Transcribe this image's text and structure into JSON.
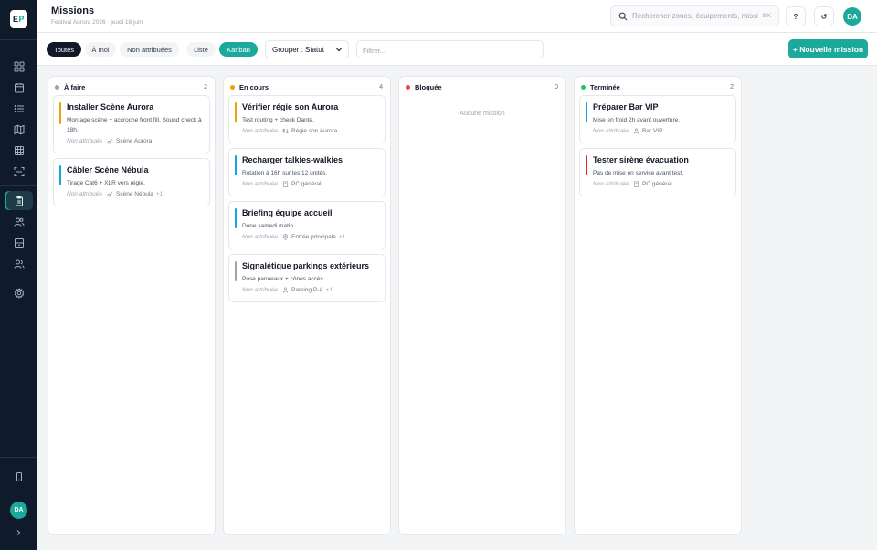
{
  "app": {
    "logo_e": "E",
    "logo_p": "P",
    "page_title": "Missions",
    "page_subtitle": "Festival Aurora 2026 · jeudi 18 juin",
    "avatar_initials": "DA"
  },
  "header": {
    "search_placeholder": "Rechercher zones, équipements, missi",
    "search_shortcut": "⌘K",
    "help_label": "?",
    "refresh_label": "↺"
  },
  "sidebar": {
    "items": [
      {
        "icon": "dashboard-icon",
        "active": false
      },
      {
        "icon": "calendar-icon",
        "active": false
      },
      {
        "icon": "list-icon",
        "active": false
      },
      {
        "icon": "map-icon",
        "active": false
      },
      {
        "icon": "grid-icon",
        "active": false
      },
      {
        "icon": "scan-icon",
        "active": false
      },
      {
        "icon": "clipboard-icon",
        "active": true
      },
      {
        "icon": "users-icon",
        "active": false
      },
      {
        "icon": "inventory-icon",
        "active": false
      },
      {
        "icon": "team-icon",
        "active": false
      },
      {
        "icon": "settings-icon",
        "active": false
      }
    ],
    "bottom": {
      "device_icon": "phone-icon",
      "avatar": "DA",
      "expand_icon": "chevron-right-icon"
    }
  },
  "toolbar": {
    "filters": [
      "Toutes",
      "À moi",
      "Non attribuées"
    ],
    "active_filter": "Toutes",
    "views": [
      "Liste",
      "Kanban"
    ],
    "active_view": "Kanban",
    "group_by": "Grouper : Statut",
    "filter_placeholder": "Filtrer...",
    "new_button": "+ Nouvelle mission"
  },
  "colors": {
    "accent": "#1aa99a",
    "todo": "#9ca3af",
    "in_progress": "#f59e0b",
    "blocked": "#ef4444",
    "done": "#22c55e",
    "bar_orange": "#f59e0b",
    "bar_blue": "#0ea5e9",
    "bar_gray": "#9ca3af",
    "bar_red": "#dc2626"
  },
  "columns": [
    {
      "title": "À faire",
      "count": "2",
      "dot": "#9ca3af",
      "empty": "",
      "cards": [
        {
          "title": "Installer Scène Aurora",
          "desc": "Montage scène + accroche front fill. Sound check à 18h.",
          "assignee": "Non attribuée",
          "location_icon": "guitar-icon",
          "location": "Scène Aurora",
          "extra": "",
          "bar": "#f59e0b"
        },
        {
          "title": "Câbler Scène Nébula",
          "desc": "Tirage Cat6 + XLR vers régie.",
          "assignee": "Non attribuée",
          "location_icon": "guitar-icon",
          "location": "Scène Nébula",
          "extra": "+1",
          "bar": "#0ea5e9"
        }
      ]
    },
    {
      "title": "En cours",
      "count": "4",
      "dot": "#f59e0b",
      "empty": "",
      "cards": [
        {
          "title": "Vérifier régie son Aurora",
          "desc": "Test routing + check Dante.",
          "assignee": "Non attribuée",
          "location_icon": "sliders-icon",
          "location": "Régie son Aurora",
          "extra": "",
          "bar": "#f59e0b"
        },
        {
          "title": "Recharger talkies-walkies",
          "desc": "Rotation à 16h sur les 12 unités.",
          "assignee": "Non attribuée",
          "location_icon": "building-icon",
          "location": "PC général",
          "extra": "",
          "bar": "#0ea5e9"
        },
        {
          "title": "Briefing équipe accueil",
          "desc": "Done samedi matin.",
          "assignee": "Non attribuée",
          "location_icon": "pin-icon",
          "location": "Entrée principale",
          "extra": "+1",
          "bar": "#0ea5e9"
        },
        {
          "title": "Signalétique parkings extérieurs",
          "desc": "Pose panneaux + cônes accès.",
          "assignee": "Non attribuée",
          "location_icon": "parking-icon",
          "location": "Parking P-A",
          "extra": "+1",
          "bar": "#9ca3af"
        }
      ]
    },
    {
      "title": "Bloquée",
      "count": "0",
      "dot": "#ef4444",
      "empty": "Aucune mission",
      "cards": []
    },
    {
      "title": "Terminée",
      "count": "2",
      "dot": "#22c55e",
      "empty": "",
      "cards": [
        {
          "title": "Préparer Bar VIP",
          "desc": "Mise en froid 2h avant ouverture.",
          "assignee": "Non attribuée",
          "location_icon": "person-icon",
          "location": "Bar VIP",
          "extra": "",
          "bar": "#0ea5e9"
        },
        {
          "title": "Tester sirène évacuation",
          "desc": "Pas de mise en service avant test.",
          "assignee": "Non attribuée",
          "location_icon": "building-icon",
          "location": "PC général",
          "extra": "",
          "bar": "#dc2626"
        }
      ]
    }
  ]
}
